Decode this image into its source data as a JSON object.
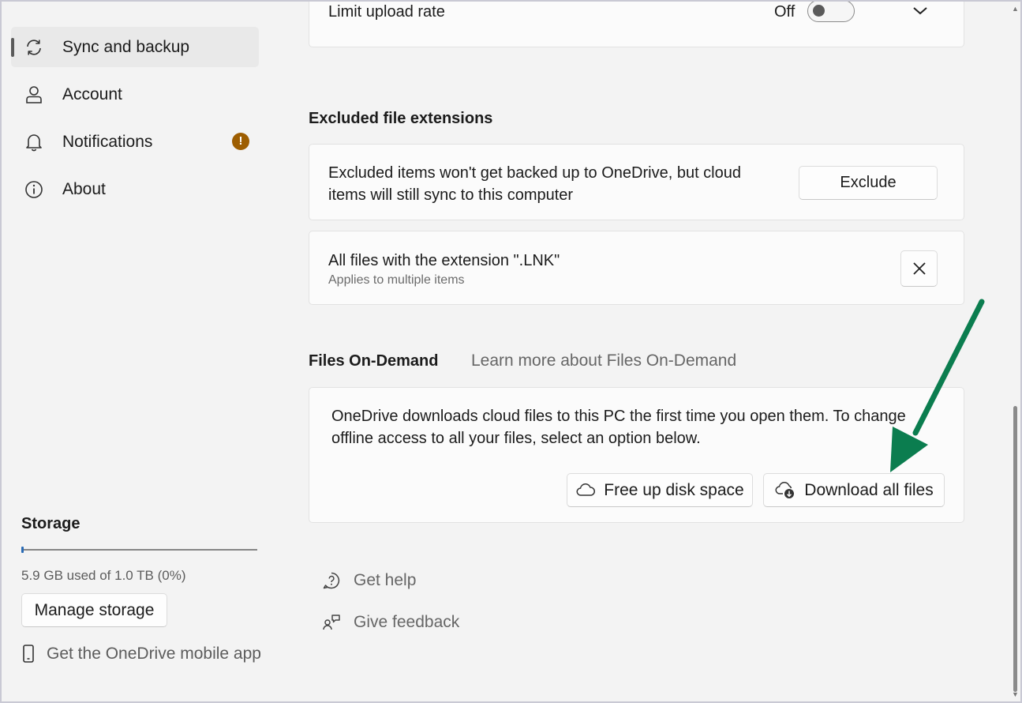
{
  "sidebar": {
    "items": [
      {
        "label": "Sync and backup",
        "icon": "sync-icon",
        "active": true
      },
      {
        "label": "Account",
        "icon": "person-icon"
      },
      {
        "label": "Notifications",
        "icon": "bell-icon",
        "badge": "!"
      },
      {
        "label": "About",
        "icon": "info-icon"
      }
    ]
  },
  "storage": {
    "title": "Storage",
    "usage_text": "5.9 GB used of 1.0 TB (0%)",
    "used_fraction": 0.0,
    "manage_label": "Manage storage",
    "mobile_app_label": "Get the OneDrive mobile app"
  },
  "upload": {
    "label": "Limit upload rate",
    "toggle_state": "Off"
  },
  "excluded": {
    "title": "Excluded file extensions",
    "description_line1": "Excluded items won't get backed up to OneDrive, but cloud",
    "description_line2": "items will still sync to this computer",
    "exclude_button": "Exclude",
    "rule_title": "All files with the extension \".LNK\"",
    "rule_subtitle": "Applies to multiple items"
  },
  "files_on_demand": {
    "title": "Files On-Demand",
    "learn_more": "Learn more about Files On-Demand",
    "description_line1": "OneDrive downloads cloud files to this PC the first time you open them. To change",
    "description_line2": "offline access to all your files, select an option below.",
    "free_up_label": "Free up disk space",
    "download_all_label": "Download all files"
  },
  "footer": {
    "get_help": "Get help",
    "give_feedback": "Give feedback"
  },
  "colors": {
    "annotation_arrow": "#0b7d4f",
    "badge": "#9d5d00",
    "storage_fill": "#2a6bb5"
  }
}
